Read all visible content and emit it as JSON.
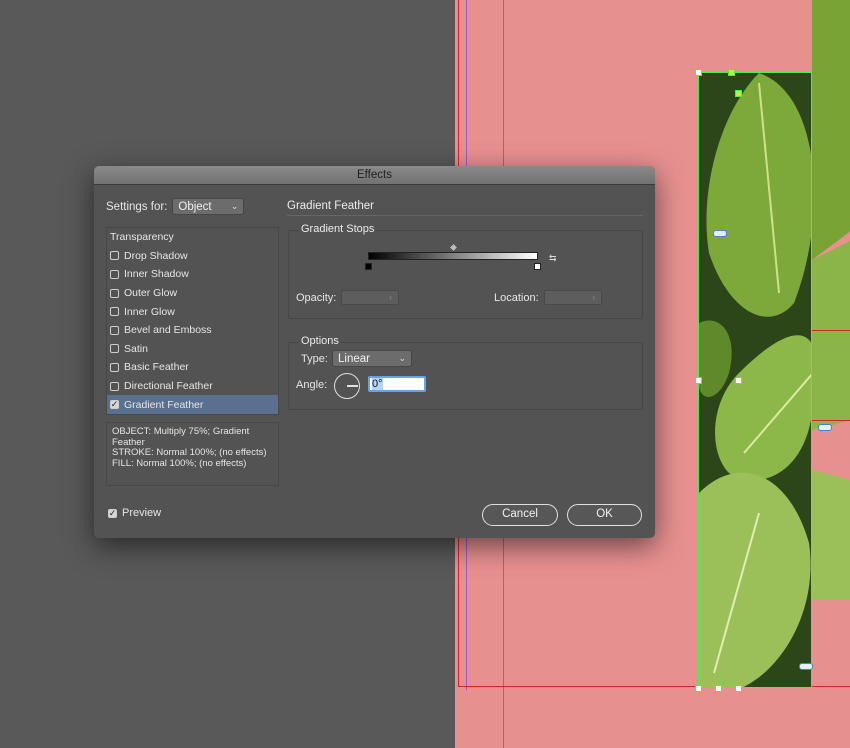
{
  "dialog": {
    "title": "Effects",
    "settings_for_label": "Settings for:",
    "settings_for_value": "Object",
    "effects_list": {
      "header": "Transparency",
      "items": [
        {
          "label": "Drop Shadow",
          "checked": false
        },
        {
          "label": "Inner Shadow",
          "checked": false
        },
        {
          "label": "Outer Glow",
          "checked": false
        },
        {
          "label": "Inner Glow",
          "checked": false
        },
        {
          "label": "Bevel and Emboss",
          "checked": false
        },
        {
          "label": "Satin",
          "checked": false
        },
        {
          "label": "Basic Feather",
          "checked": false
        },
        {
          "label": "Directional Feather",
          "checked": false
        },
        {
          "label": "Gradient Feather",
          "checked": true,
          "selected": true
        }
      ]
    },
    "summary": {
      "object": "OBJECT: Multiply 75%; Gradient Feather",
      "stroke": "STROKE: Normal 100%; (no effects)",
      "fill": "FILL: Normal 100%; (no effects)"
    },
    "preview": {
      "label": "Preview",
      "checked": true
    },
    "panel": {
      "title": "Gradient Feather",
      "gradient_stops": {
        "label": "Gradient Stops",
        "opacity_label": "Opacity:",
        "location_label": "Location:"
      },
      "options": {
        "label": "Options",
        "type_label": "Type:",
        "type_value": "Linear",
        "angle_label": "Angle:",
        "angle_value": "0°"
      }
    },
    "buttons": {
      "cancel": "Cancel",
      "ok": "OK"
    }
  },
  "colors": {
    "dialog_bg": "#535353",
    "pasteboard": "#595959",
    "page": "#e79090",
    "selection": "#4af04a",
    "frame_edge": "#d1262a",
    "selected_row": "#5a7090"
  }
}
